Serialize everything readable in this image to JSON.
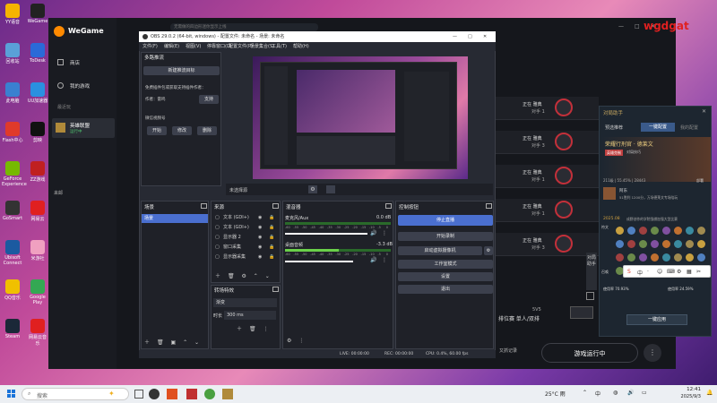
{
  "desktop": {
    "icons": [
      {
        "label": "YY语音",
        "color": "#f5b400"
      },
      {
        "label": "回收站",
        "color": "#5aa0d8"
      },
      {
        "label": "此电脑",
        "color": "#3a80d0"
      },
      {
        "label": "Flash中心",
        "color": "#e03a2a"
      },
      {
        "label": "GeForce Experience",
        "color": "#76b900"
      },
      {
        "label": "GoSmart",
        "color": "#333"
      },
      {
        "label": "Ubisoft Connect",
        "color": "#1b5aa0"
      },
      {
        "label": "QQ音乐",
        "color": "#f0c000"
      },
      {
        "label": "Steam",
        "color": "#1b2838"
      }
    ],
    "icons2": [
      {
        "label": "WeGame",
        "color": "#222"
      },
      {
        "label": "ToDesk",
        "color": "#2a6ad8"
      },
      {
        "label": "UU加速器",
        "color": "#2a90e0"
      },
      {
        "label": "剪映",
        "color": "#111"
      },
      {
        "label": "ZZ游戏",
        "color": "#c02020"
      },
      {
        "label": "网易云",
        "color": "#e02020"
      },
      {
        "label": "米游社",
        "color": "#f0a0c0"
      },
      {
        "label": "Google Play",
        "color": "#34a853"
      },
      {
        "label": "网易云音乐",
        "color": "#e02020"
      }
    ]
  },
  "wegame": {
    "logo": "WeGame",
    "nav": [
      "商店",
      "我的游戏",
      "最近玩",
      "英雄联盟",
      "运行中"
    ],
    "label_lai": "来邮",
    "launch_button": "游戏运行中",
    "side_list": [
      {
        "line1": "正在 雅典",
        "line2": "对手 1"
      },
      {
        "line1": "正在 雅典",
        "line2": "对手 3"
      },
      {
        "line1": "正在 雅典",
        "line2": "对手 1"
      },
      {
        "line1": "正在 雅典",
        "line2": "对手 1"
      },
      {
        "line1": "正在 雅典",
        "line2": "对手 3"
      }
    ],
    "rank_text": "排位赛 单人/双排",
    "ss": "5V5",
    "brand": "wgdgat",
    "help": "对局助手"
  },
  "obs": {
    "title": "OBS 29.0.2 (64-bit, windows) - 配置文件: 未命名 - 场景: 未命名",
    "search_placeholder": "无需做的四边形迷你显示上线",
    "menu": [
      "文件(F)",
      "编辑(E)",
      "视图(V)",
      "停靠窗口(D)",
      "配置文件(P)",
      "场景集合(S)",
      "工具(T)",
      "帮助(H)"
    ],
    "plugin": {
      "title": "多路推流",
      "new_btn": "新建推流目标",
      "free_text": "免费插件包或获取支持插件作者：",
      "author_label": "作者：雷鸣",
      "support_btn": "支持",
      "wechat": "微信视频号",
      "start": "开始",
      "modify": "修改",
      "delete": "删除"
    },
    "no_source": "未选择源",
    "scenes": {
      "title": "场景",
      "item": "场景"
    },
    "sources": {
      "title": "来源",
      "items": [
        "文本 (GDI+)",
        "文本 (GDI+)",
        "显示器 2",
        "窗口采集",
        "显示器采集"
      ]
    },
    "mixer": {
      "title": "混音器",
      "ch1": {
        "name": "麦克风/Aux",
        "db": "0.0 dB"
      },
      "ch2": {
        "name": "桌面音频",
        "db": "-3.3 dB"
      },
      "ticks": [
        "-60",
        "-55",
        "-50",
        "-45",
        "-40",
        "-35",
        "-30",
        "-25",
        "-20",
        "-15",
        "-10",
        "-5",
        "0"
      ]
    },
    "controls": {
      "title": "控制按钮",
      "buttons": [
        "停止直播",
        "开始录制",
        "启动虚拟摄像机",
        "工作室模式",
        "设置",
        "退出"
      ]
    },
    "transitions": {
      "title": "转场特效",
      "type": "渐变",
      "duration_label": "时长",
      "duration_value": "300 ms"
    },
    "status": {
      "live": "LIVE: 00:00:00",
      "rec": "REC: 00:00:00",
      "cpu": "CPU: 0.4%, 60.00 fps"
    }
  },
  "right_panel": {
    "title": "对局助手",
    "tabs": [
      "预选推荐",
      "一键配置",
      "我的配置"
    ],
    "hero_name": "荣耀行刑官 · 德莱文",
    "tag1": "英雄克制",
    "tag2": "对局技巧",
    "sub": "211级 | 55.45% | 28443",
    "btn_deploy": "部署",
    "player": "阿东",
    "desc_line": "51胜利 1200分，万场德莱文专场陪玩",
    "tag_year": "2025.08",
    "desc2": "成野创作的学院强棋加强大型比赛",
    "use_rate1": "使用率 70.93%",
    "use_rate2": "使用率 24.59%",
    "apply": "一键应用",
    "side_tabs": [
      "符文",
      "召唤"
    ]
  },
  "taskbar": {
    "search": "搜索",
    "weather": "25°C 雨",
    "lang": "中",
    "time": "12:41",
    "date": "2025/9/3"
  },
  "float_toolbar": {
    "items": [
      "S",
      "中",
      "·",
      "☺",
      "⌨",
      "⚙",
      "▦",
      "✂"
    ]
  },
  "wg_bottom": {
    "save": "正在录制 1 页",
    "rec_btn": "又抓记录"
  }
}
